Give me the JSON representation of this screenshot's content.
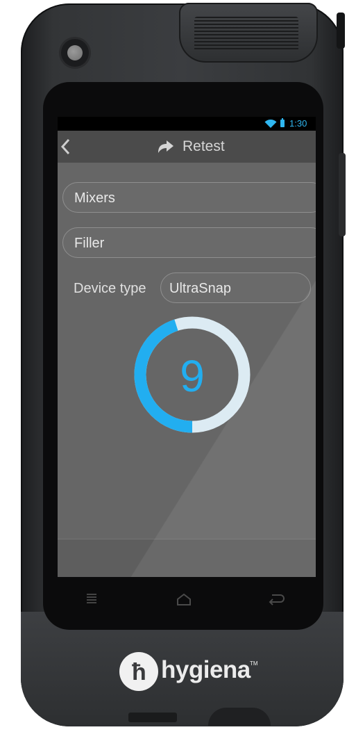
{
  "status_bar": {
    "time": "1:30",
    "wifi_icon": "wifi-icon",
    "battery_icon": "battery-icon"
  },
  "action_bar": {
    "back_icon": "chevron-left-icon",
    "title_icon": "retest-arrow-icon",
    "title": "Retest"
  },
  "form": {
    "location_1": "Mixers",
    "location_2": "Filler",
    "device_type_label": "Device type",
    "device_type_value": "UltraSnap"
  },
  "countdown": {
    "value": "9",
    "progress_fraction": 0.45
  },
  "nav_bar": {
    "menu_icon": "menu-icon",
    "home_icon": "home-icon",
    "back_icon": "back-arrow-icon"
  },
  "hardware": {
    "brand": "hygiena",
    "trademark": "TM",
    "logo_icon": "hygiena-logo-icon"
  },
  "colors": {
    "accent": "#2fb6f0",
    "screen_bg": "#666666",
    "action_bar": "#4b4b4b"
  }
}
